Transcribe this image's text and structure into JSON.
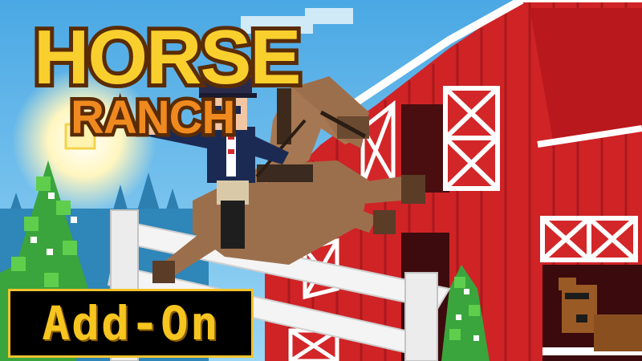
{
  "title": {
    "line1": "HORSE",
    "line2": "RANCH"
  },
  "badge": {
    "label": "Add-On"
  },
  "colors": {
    "sky": "#5fb8e8",
    "barn_red": "#d4282a",
    "barn_trim": "#ffffff",
    "fence": "#f5f5f5",
    "tree_green": "#35a83a",
    "title_yellow": "#f9cf2e",
    "title_orange": "#f08a1f",
    "badge_text": "#f7c51f",
    "horse_brown": "#9b7051",
    "rider_navy": "#1b2a52"
  },
  "icons": [
    "sun-icon",
    "barn-icon",
    "horse-icon",
    "rider-icon",
    "fence-icon",
    "tree-icon"
  ]
}
